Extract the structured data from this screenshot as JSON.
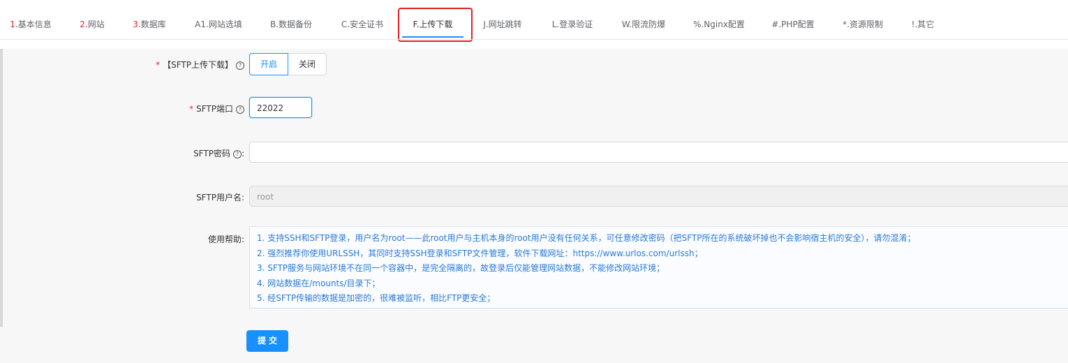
{
  "tabs": [
    {
      "num": "1.",
      "label": "基本信息",
      "colored": true
    },
    {
      "num": "2.",
      "label": "网站",
      "colored": true
    },
    {
      "num": "3.",
      "label": "数据库",
      "colored": true
    },
    {
      "num": "",
      "label": "A1.网站选填",
      "colored": false
    },
    {
      "num": "",
      "label": "B.数据备份",
      "colored": false
    },
    {
      "num": "",
      "label": "C.安全证书",
      "colored": false
    },
    {
      "num": "",
      "label": "F.上传下载",
      "colored": false,
      "active": true
    },
    {
      "num": "",
      "label": "J.网址跳转",
      "colored": false
    },
    {
      "num": "",
      "label": "L.登录验证",
      "colored": false
    },
    {
      "num": "",
      "label": "W.限流防爆",
      "colored": false
    },
    {
      "num": "",
      "label": "%.Nginx配置",
      "colored": false
    },
    {
      "num": "",
      "label": "#.PHP配置",
      "colored": false
    },
    {
      "num": "",
      "label": "*.资源限制",
      "colored": false
    },
    {
      "num": "",
      "label": "!.其它",
      "colored": false
    }
  ],
  "form": {
    "sftp_toggle": {
      "required": "*",
      "label": "【SFTP上传下载】",
      "help_icon": "?",
      "on_label": "开启",
      "off_label": "关闭",
      "selected": "开启"
    },
    "sftp_port": {
      "required": "*",
      "label": "SFTP端口",
      "help_icon": "?",
      "value": "22022"
    },
    "sftp_password": {
      "label": "SFTP密码",
      "help_icon": "?",
      "colon": ":",
      "value": ""
    },
    "sftp_user": {
      "label": "SFTP用户名",
      "colon": ":",
      "value": "root"
    },
    "usage_help": {
      "label": "使用帮助",
      "colon": ":",
      "lines": [
        "1. 支持SSH和SFTP登录，用户名为root——此root用户与主机本身的root用户没有任何关系，可任意修改密码（把SFTP所在的系统破坏掉也不会影响宿主机的安全），请勿混淆；",
        "2. 强烈推荐你使用URLSSH，其同时支持SSH登录和SFTP文件管理，软件下载网址：https://www.urlos.com/urlssh；",
        "3. SFTP服务与网站环境不在同一个容器中，是完全隔离的，故登录后仅能管理网站数据，不能修改网站环境；",
        "4. 网站数据在/mounts/目录下；",
        "5. 经SFTP传输的数据是加密的，很难被监听，相比FTP更安全；"
      ]
    },
    "submit_label": "提交"
  },
  "colors": {
    "accent": "#1890ff",
    "tab_number": "#e02020",
    "highlight_box": "#e02020",
    "help_text": "#2b7ad6"
  }
}
